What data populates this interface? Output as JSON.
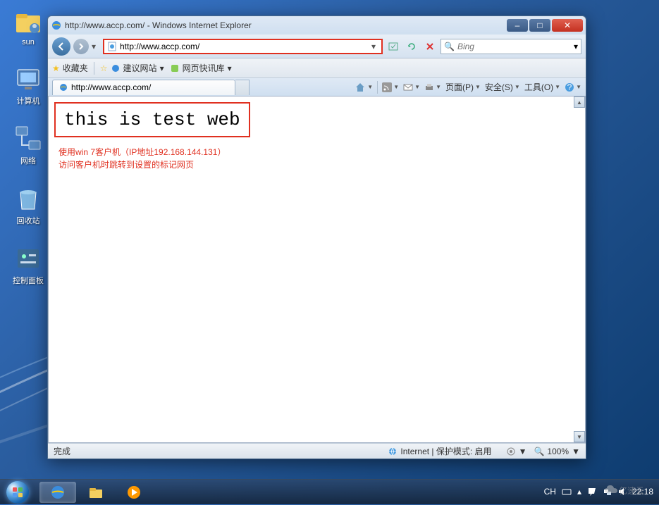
{
  "desktop": {
    "icons": [
      {
        "label": "sun"
      },
      {
        "label": "计算机"
      },
      {
        "label": "网络"
      },
      {
        "label": "回收站"
      },
      {
        "label": "控制面板"
      }
    ]
  },
  "window": {
    "title": "http://www.accp.com/ - Windows Internet Explorer",
    "minimize": "–",
    "maximize": "□",
    "close": "✕"
  },
  "nav": {
    "url": "http://www.accp.com/",
    "search_placeholder": "Bing"
  },
  "favbar": {
    "favorites": "收藏夹",
    "suggested": "建议网站",
    "slice_lib": "网页快讯库"
  },
  "tab": {
    "title": "http://www.accp.com/"
  },
  "cmd": {
    "page": "页面(P)",
    "safety": "安全(S)",
    "tools": "工具(O)"
  },
  "page": {
    "heading": "this is test web",
    "annotation_line1": "使用win 7客户机（IP地址192.168.144.131）",
    "annotation_line2": "访问客户机时跳转到设置的标记网页"
  },
  "status": {
    "done": "完成",
    "zone": "Internet | 保护模式: 启用",
    "zoom": "100%"
  },
  "tray": {
    "lang": "CH",
    "time": "22:18"
  },
  "watermark": "亿速云"
}
